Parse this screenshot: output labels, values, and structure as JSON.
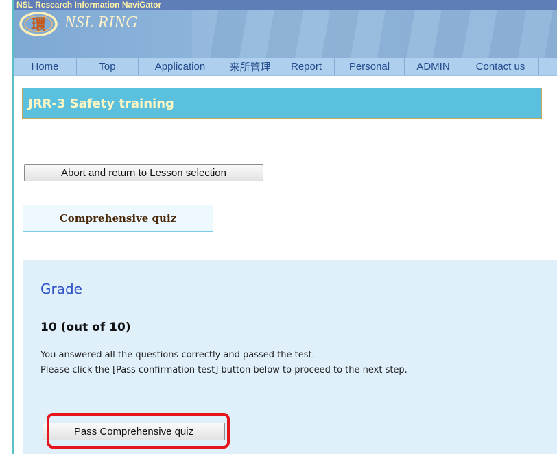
{
  "header": {
    "app_title": "NSL Research Information NaviGator",
    "logo_glyph": "環",
    "logo_text": "NSL RING"
  },
  "nav": {
    "items": [
      {
        "label": "Home"
      },
      {
        "label": "Top"
      },
      {
        "label": "Application"
      },
      {
        "label": "来所管理"
      },
      {
        "label": "Report"
      },
      {
        "label": "Personal"
      },
      {
        "label": "ADMIN"
      },
      {
        "label": "Contact us"
      }
    ]
  },
  "page": {
    "title": "JRR-3 Safety training"
  },
  "actions": {
    "abort_label": "Abort and return to Lesson selection"
  },
  "quiz": {
    "tab_label": "Comprehensive quiz"
  },
  "result": {
    "heading": "Grade",
    "score": "10 (out of 10)",
    "message_line1": "You answered all the questions correctly and passed the test.",
    "message_line2": "Please click the [Pass confirmation test] button below to proceed to the next step.",
    "pass_button_label": "Pass Comprehensive quiz"
  },
  "colors": {
    "header_blue": "#8eb3da",
    "title_bar": "#5bc0de",
    "title_text": "#fff6c2",
    "grade_heading": "#2f54c8",
    "panel_bg": "#dff0fb",
    "highlight": "#e6141c"
  }
}
